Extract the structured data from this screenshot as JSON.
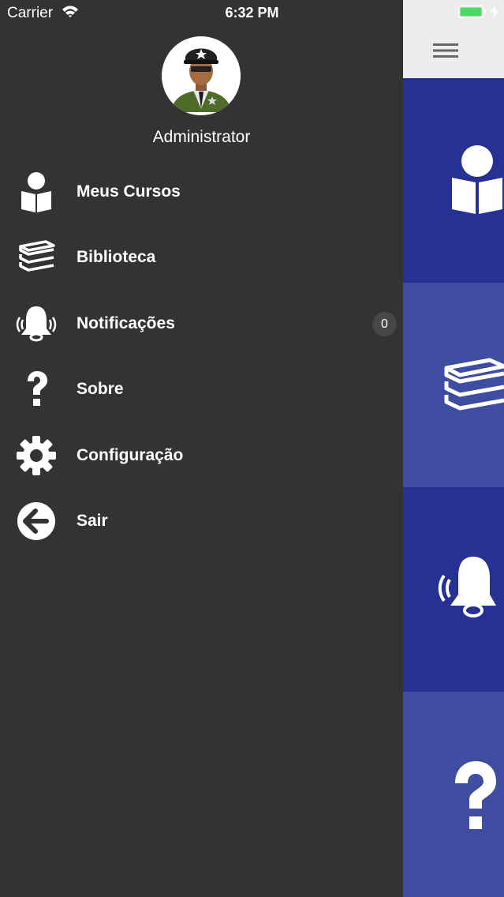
{
  "status_bar": {
    "carrier": "Carrier",
    "time": "6:32 PM",
    "battery_color": "#4cd964"
  },
  "drawer": {
    "user_name": "Administrator",
    "items": [
      {
        "label": "Meus Cursos",
        "icon": "book-reader-icon"
      },
      {
        "label": "Biblioteca",
        "icon": "books-stack-icon"
      },
      {
        "label": "Notificações",
        "icon": "ringing-bell-icon",
        "badge": "0"
      },
      {
        "label": "Sobre",
        "icon": "question-icon"
      },
      {
        "label": "Configuração",
        "icon": "gear-icon"
      },
      {
        "label": "Sair",
        "icon": "arrow-left-circle-icon"
      }
    ]
  },
  "main": {
    "menu_icon": "hamburger-icon",
    "tiles": [
      {
        "icon": "book-reader-icon",
        "color": "#273193"
      },
      {
        "icon": "books-stack-icon",
        "color": "#3e4da0"
      },
      {
        "icon": "ringing-bell-icon",
        "color": "#273193"
      },
      {
        "icon": "question-icon",
        "color": "#3e4da0"
      }
    ]
  },
  "colors": {
    "drawer_bg": "#333335",
    "badge_bg": "#47474a",
    "nav_bar_bg": "#ececec"
  }
}
